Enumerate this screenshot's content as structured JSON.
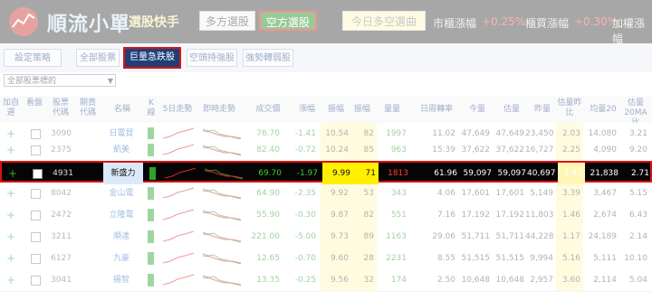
{
  "header": {
    "app_title": "順流小單",
    "app_subtitle": "選股快手",
    "long_btn": "多方選股",
    "short_btn": "空方選股",
    "today_btn": "今日多空選曲",
    "idx1_label": "市櫃漲幅",
    "idx1_value": "+0.25%",
    "idx2_label": "櫃買漲幅",
    "idx2_value": "+0.30%",
    "idx3_label": "加權漲幅"
  },
  "toolbar": {
    "strategy": "設定策略",
    "all": "全部股票",
    "volume_drop": "巨量急跌股",
    "empty_hold": "空頭持強股",
    "strong_weak": "強勢轉弱股"
  },
  "filter": {
    "value": "全部股票標的",
    "arrow": "▼"
  },
  "columns": {
    "add": "加自選",
    "watch": "看盤",
    "code": "股票代碼",
    "futures": "期貨代碼",
    "name": "名稱",
    "k": "K線",
    "trend5": "5日走勢",
    "intraday": "即時走勢",
    "price": "成交價",
    "change": "漲幅",
    "pct": "振幅",
    "vol_ratio": "振幅",
    "amount": "量量",
    "turnover": "日周轉率",
    "vol_today": "今量",
    "est_vol": "估量",
    "prev_vol": "昨量",
    "est_ratio": "估量昨比",
    "avg20": "均量20",
    "ma20": "估量20MA比"
  },
  "rows": [
    {
      "code": "3090",
      "name": "日電貿",
      "price": "76.70",
      "change": "-1.41",
      "pct": "10.54",
      "r": "82",
      "amt": "1997",
      "turn": "11.02",
      "v1": "47,649",
      "v2": "47,649",
      "v3": "23,450",
      "ratio": "2.03",
      "avg": "14,080",
      "ma": "3.21"
    },
    {
      "code": "2375",
      "name": "凱美",
      "price": "82.40",
      "change": "-0.72",
      "pct": "10.24",
      "r": "85",
      "amt": "963",
      "turn": "15.39",
      "v1": "37,622",
      "v2": "37,622",
      "v3": "16,727",
      "ratio": "2.25",
      "avg": "4,090",
      "ma": "9.20"
    },
    {
      "code": "4931",
      "name": "新盛力",
      "price": "69.70",
      "change": "-1.97",
      "pct": "9.99",
      "r": "71",
      "amt": "1813",
      "turn": "61.96",
      "v1": "59,097",
      "v2": "59,097",
      "v3": "40,697",
      "ratio": "1.45",
      "avg": "21,838",
      "ma": "2.71"
    },
    {
      "code": "8042",
      "name": "金山電",
      "price": "64.90",
      "change": "-2.35",
      "pct": "9.92",
      "r": "53",
      "amt": "343",
      "turn": "4.06",
      "v1": "17,601",
      "v2": "17,601",
      "v3": "5,149",
      "ratio": "3.39",
      "avg": "3,467",
      "ma": "5.15"
    },
    {
      "code": "2472",
      "name": "立隆電",
      "price": "55.90",
      "change": "-0.30",
      "pct": "9.87",
      "r": "82",
      "amt": "551",
      "turn": "7.16",
      "v1": "17,192",
      "v2": "17,192",
      "v3": "11,803",
      "ratio": "1.46",
      "avg": "2,674",
      "ma": "6.43"
    },
    {
      "code": "3211",
      "name": "順達",
      "price": "221.00",
      "change": "-5.00",
      "pct": "9.73",
      "r": "89",
      "amt": "1163",
      "turn": "29.06",
      "v1": "51,711",
      "v2": "51,711",
      "v3": "44,228",
      "ratio": "1.17",
      "avg": "24,189",
      "ma": "2.14"
    },
    {
      "code": "6127",
      "name": "九豪",
      "price": "12.65",
      "change": "-0.70",
      "pct": "9.60",
      "r": "28",
      "amt": "2231",
      "turn": "8.55",
      "v1": "51,515",
      "v2": "51,515",
      "v3": "9,994",
      "ratio": "5.16",
      "avg": "5,111",
      "ma": "10.10"
    },
    {
      "code": "3041",
      "name": "揚智",
      "price": "13.35",
      "change": "-0.25",
      "pct": "9.56",
      "r": "32",
      "amt": "174",
      "turn": "2.50",
      "v1": "10,648",
      "v2": "10,648",
      "v3": "2,957",
      "ratio": "3.60",
      "avg": "2,114",
      "ma": "5.04"
    }
  ],
  "colors": {
    "accent_red": "#d11",
    "brand_green": "#1b8a1b",
    "highlight_yellow": "#fff6b8"
  }
}
